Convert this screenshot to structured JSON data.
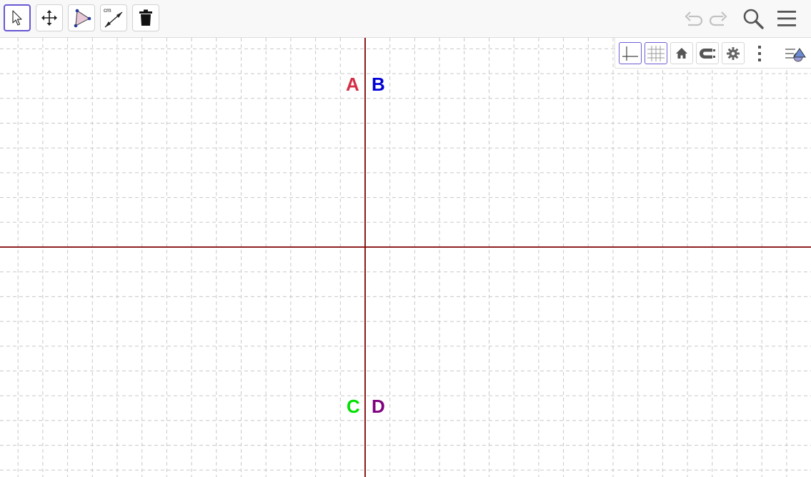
{
  "toolbar": {
    "tools": [
      {
        "name": "move-tool",
        "icon": "pointer-arrow-icon",
        "selected": true
      },
      {
        "name": "move-graphics-view-tool",
        "icon": "four-way-arrow-icon",
        "selected": false
      },
      {
        "name": "polygon-tool",
        "icon": "triangle-icon",
        "selected": false
      },
      {
        "name": "distance-tool",
        "icon": "ruler-segment-icon",
        "label": "cm",
        "selected": false
      },
      {
        "name": "delete-tool",
        "icon": "trash-icon",
        "selected": false
      }
    ],
    "right": [
      "undo-icon",
      "redo-icon",
      "search-icon",
      "menu-icon"
    ]
  },
  "stylebar": {
    "buttons": [
      "axes-icon",
      "grid-icon",
      "home-icon",
      "magnet-icon",
      "gear-icon",
      "kebab-icon",
      "algebra-toggle-icon"
    ],
    "axes_active": true,
    "grid_active": true
  },
  "graphics": {
    "axis_color": "#7f0000",
    "grid_color": "#c8c8c8",
    "points": [
      {
        "label": "A",
        "color": "#d32f45"
      },
      {
        "label": "B",
        "color": "#0000d6"
      },
      {
        "label": "C",
        "color": "#00e000"
      },
      {
        "label": "D",
        "color": "#800080"
      }
    ]
  }
}
